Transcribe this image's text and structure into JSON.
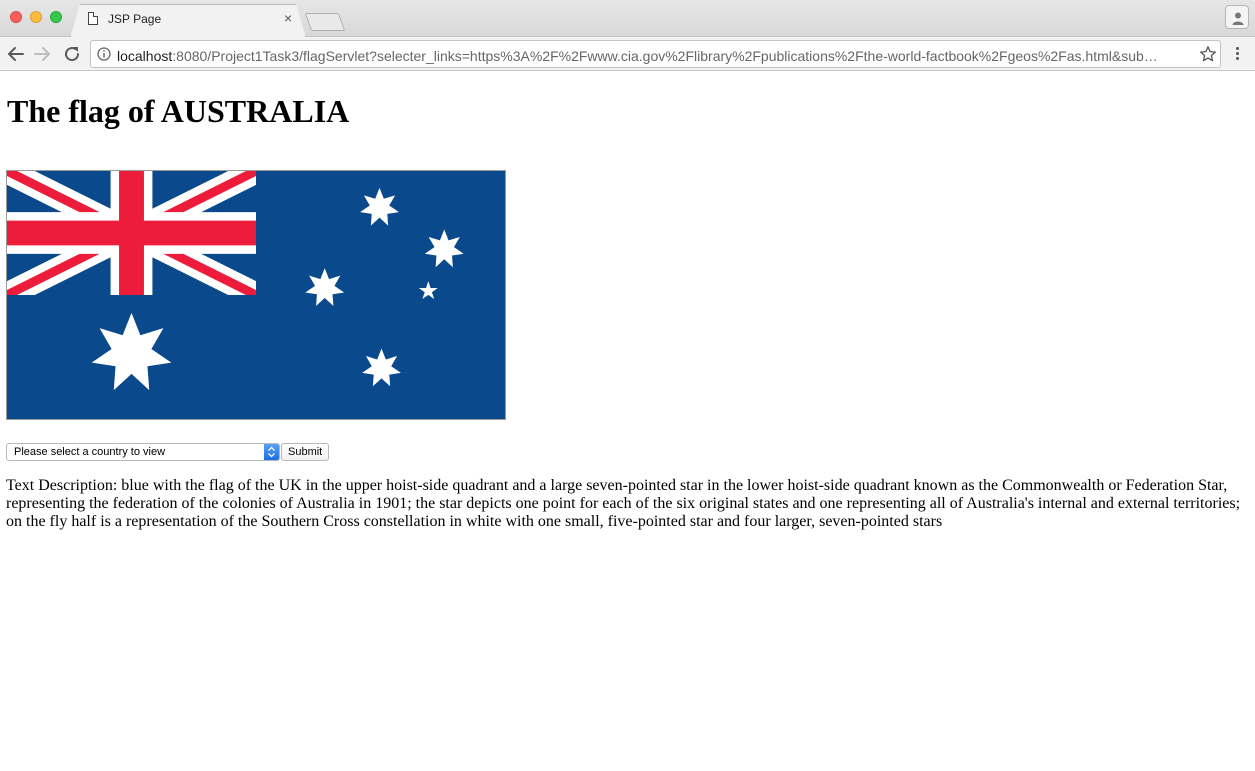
{
  "browser": {
    "tab_title": "JSP Page",
    "tab_close": "×",
    "url_host": "localhost",
    "url_rest": ":8080/Project1Task3/flagServlet?selecter_links=https%3A%2F%2Fwww.cia.gov%2Flibrary%2Fpublications%2Fthe-world-factbook%2Fgeos%2Fas.html&sub…",
    "icons": [
      "document-icon",
      "close-icon",
      "back-icon",
      "forward-icon",
      "reload-icon",
      "info-icon",
      "bookmark-star-icon",
      "menu-icon",
      "profile-icon"
    ]
  },
  "page": {
    "heading": "The flag of AUSTRALIA",
    "flag": {
      "country": "AUSTRALIA",
      "colors": {
        "field": "#0a4a8c",
        "cross_red": "#ee1c3b",
        "white": "#ffffff"
      }
    },
    "form": {
      "select_value": "Please select a country to view",
      "submit_label": "Submit"
    },
    "description": "Text Description: blue with the flag of the UK in the upper hoist-side quadrant and a large seven-pointed star in the lower hoist-side quadrant known as the Commonwealth or Federation Star, representing the federation of the colonies of Australia in 1901; the star depicts one point for each of the six original states and one representing all of Australia's internal and external territories; on the fly half is a representation of the Southern Cross constellation in white with one small, five-pointed star and four larger, seven-pointed stars"
  }
}
